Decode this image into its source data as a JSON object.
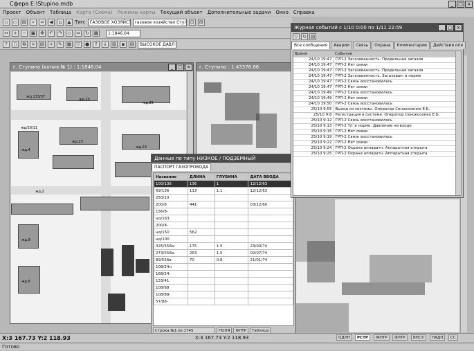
{
  "app": {
    "title": "Сфера E:\\Stupino.mdb"
  },
  "menu": [
    "Проект",
    "Объект",
    "Таблица",
    "Карта (Схема)",
    "Режимы карты",
    "Текущий объект",
    "Дополнительные задачи",
    "Окно",
    "Справка"
  ],
  "toolbar": {
    "type_label": "Тип:",
    "type_value": "ГАЗОВОЕ ХОЗЯЙСТВ",
    "owner_value": "газовое хозяйство Ступ",
    "scale_value": "1:1846.04",
    "pressure_value": "ВЫСОКОЕ ДАВЛ"
  },
  "map1": {
    "title": "г. Ступино (копия № 1) : 1:1846.04",
    "labels": [
      "жд.133/37",
      "жд.25",
      "жд.25",
      "жд/16/11",
      "жд.23",
      "жд.4",
      "жд.23",
      "жд.9",
      "жд.6",
      "жд.2"
    ]
  },
  "map2": {
    "title": "г. Ступино : 1:43376.66"
  },
  "data_window": {
    "title": "Данные по типу НИЗКОЕ / ПОДЗЕМНЫЙ",
    "tab": "ПАСПОРТ ГАЗОПРОВОДА",
    "columns": [
      "Название",
      "ДЛИНА",
      "ГЛУБИНА",
      "ДАТА ВВОДА"
    ],
    "rows": [
      [
        "100/136",
        "136",
        "1",
        "12/12/63"
      ],
      [
        "69/136",
        "113",
        "1.1",
        "12/12/63"
      ],
      [
        "250/10",
        "",
        "",
        ""
      ],
      [
        "200/8",
        "441",
        "",
        "03/12/60"
      ],
      [
        "156/8-",
        "",
        "",
        ""
      ],
      [
        "нд/163",
        "",
        "",
        ""
      ],
      [
        "200/8-",
        "",
        "",
        ""
      ],
      [
        "нд/150",
        "562",
        "",
        ""
      ],
      [
        "нд/100",
        "",
        "",
        ""
      ],
      [
        "325/556в-",
        "175",
        "1.5",
        "23/03/74"
      ],
      [
        "273/556в-",
        "263",
        "1.5",
        "02/07/74"
      ],
      [
        "89/556в-",
        "70",
        "0.8",
        "21/01/74"
      ],
      [
        "108/24н",
        "",
        "",
        ""
      ],
      [
        "168/24-",
        "",
        "",
        ""
      ],
      [
        "133/41",
        "",
        "",
        ""
      ],
      [
        "108/88",
        "",
        "",
        ""
      ],
      [
        "108/88-",
        "",
        "",
        ""
      ],
      [
        "57/88-",
        "",
        "",
        ""
      ]
    ],
    "status": [
      "Строка №1 из 1745",
      "ПОЛЯ",
      "ФЛТР",
      "Таблица"
    ]
  },
  "journal": {
    "title": "Журнал событий с 1/10 0:00 по 1/11 22:59",
    "tabs": [
      "Все сообщения",
      "Аварии",
      "Связь",
      "Охрана",
      "Комментарии",
      "Действия опе"
    ],
    "columns": [
      "Время",
      "Событие"
    ],
    "rows": [
      [
        "24/10 19:47",
        "ГРП-2 Загазованность. Предельная загазов"
      ],
      [
        "24/10 19:47",
        "ГРП-2 Нет связи"
      ],
      [
        "24/10 19:47",
        "ГРП-2 Загазованность. Предельная загазов"
      ],
      [
        "24/10 19:47",
        "ГРП-2 Загазованность. Загазован. в норме"
      ],
      [
        "24/10 19:47",
        "ГРП-2 Связь восстановилась"
      ],
      [
        "24/10 19:47",
        "ГРП-2 Нет связи"
      ],
      [
        "24/10 19:49",
        "ГРП-2 Связь восстановилась"
      ],
      [
        "24/10 19:49",
        "ГРП-2 Нет связи"
      ],
      [
        "24/10 19:50",
        "ГРП-2 Связь восстановилась"
      ],
      [
        "25/10 9:55",
        "Выход из системы. Оператор Сенокосенко Е.Б."
      ],
      [
        "25/10 9:8",
        "Регистрация в системе. Оператор Сенокосенко Е.Б."
      ],
      [
        "25/10 9:12",
        "ГРП-2 Связь восстановилась"
      ],
      [
        "25/10 9:13",
        "ГРП-2 Т/г в норме. Давление на входе"
      ],
      [
        "25/10 9:15",
        "ГРП-2 Нет связи"
      ],
      [
        "25/10 9:19",
        "ГРП-2 Связь восстановилась"
      ],
      [
        "25/10 9:22",
        "ГРП-2 Нет связи"
      ],
      [
        "25/10 9:24",
        "ГРП-2 Охрана аппаратн. Аппаратная открыта"
      ],
      [
        "25/10 9:25",
        "ГРП-2 Охрана аппаратн. Аппаратная открыта"
      ]
    ]
  },
  "coords": "X:3 167.73 Y:2 118.93",
  "coords2": "X:3 167.73 Y:2 118.93",
  "indicators": [
    "ОДЛН",
    "РСТР",
    "ЖНТР",
    "ФЛТР",
    "ВНСХ",
    "НАДП",
    "СС"
  ],
  "status_text": "Готово"
}
